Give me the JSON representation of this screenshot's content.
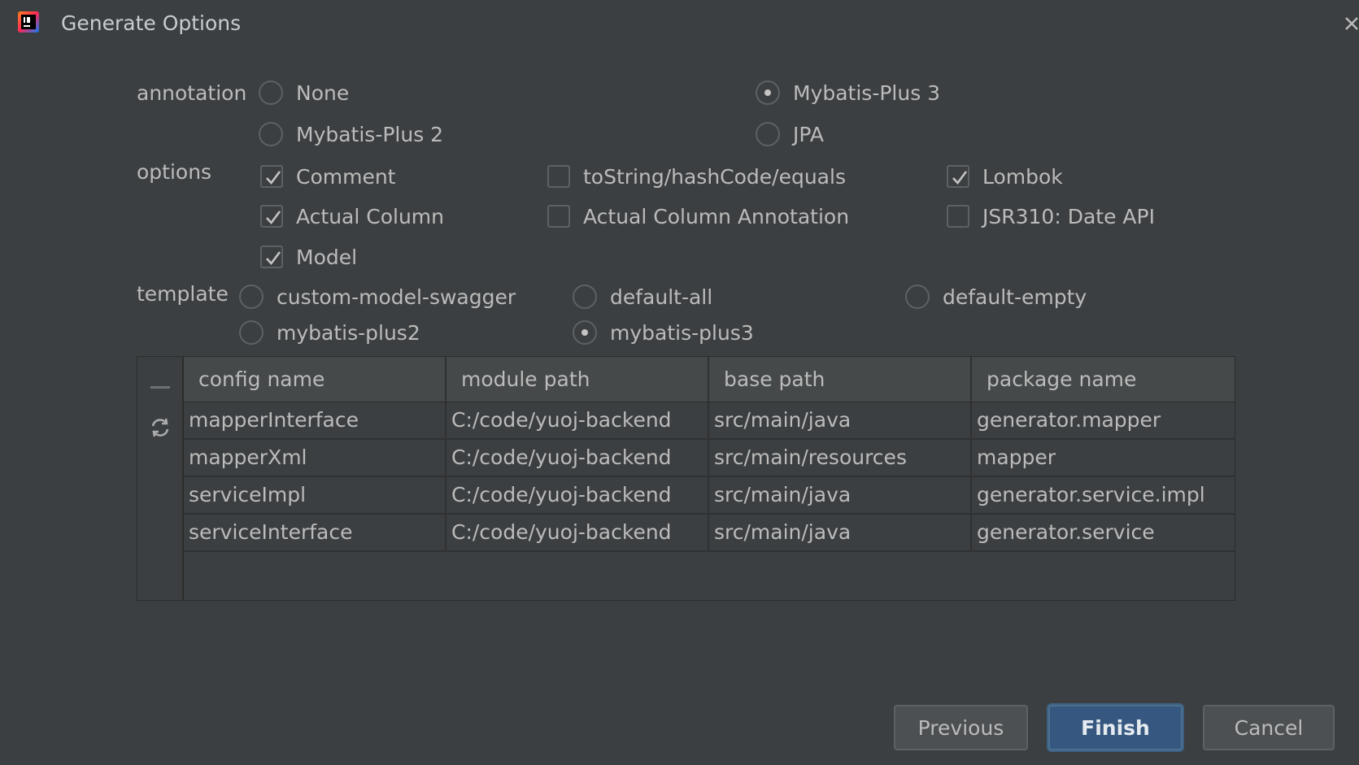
{
  "window": {
    "title": "Generate Options"
  },
  "annotation": {
    "label": "annotation",
    "options": [
      "None",
      "Mybatis-Plus 3",
      "Mybatis-Plus 2",
      "JPA"
    ],
    "selected": "Mybatis-Plus 3"
  },
  "options": {
    "label": "options",
    "items": [
      {
        "label": "Comment",
        "checked": true
      },
      {
        "label": "toString/hashCode/equals",
        "checked": false
      },
      {
        "label": "Lombok",
        "checked": true
      },
      {
        "label": "Actual Column",
        "checked": true
      },
      {
        "label": "Actual Column Annotation",
        "checked": false
      },
      {
        "label": "JSR310: Date API",
        "checked": false
      },
      {
        "label": "Model",
        "checked": true
      }
    ]
  },
  "template": {
    "label": "template",
    "options": [
      "custom-model-swagger",
      "default-all",
      "default-empty",
      "mybatis-plus2",
      "mybatis-plus3"
    ],
    "selected": "mybatis-plus3"
  },
  "table": {
    "columns": [
      "config name",
      "module path",
      "base path",
      "package name"
    ],
    "rows": [
      [
        "mapperInterface",
        "C:/code/yuoj-backend",
        "src/main/java",
        "generator.mapper"
      ],
      [
        "mapperXml",
        "C:/code/yuoj-backend",
        "src/main/resources",
        "mapper"
      ],
      [
        "serviceImpl",
        "C:/code/yuoj-backend",
        "src/main/java",
        "generator.service.impl"
      ],
      [
        "serviceInterface",
        "C:/code/yuoj-backend",
        "src/main/java",
        "generator.service"
      ]
    ],
    "toolbar_icons": [
      "minus-icon",
      "refresh-icon"
    ]
  },
  "buttons": {
    "previous": "Previous",
    "finish": "Finish",
    "cancel": "Cancel"
  },
  "colors": {
    "background": "#3c3f41",
    "accent": "#365880",
    "text": "#bbbbbb"
  }
}
